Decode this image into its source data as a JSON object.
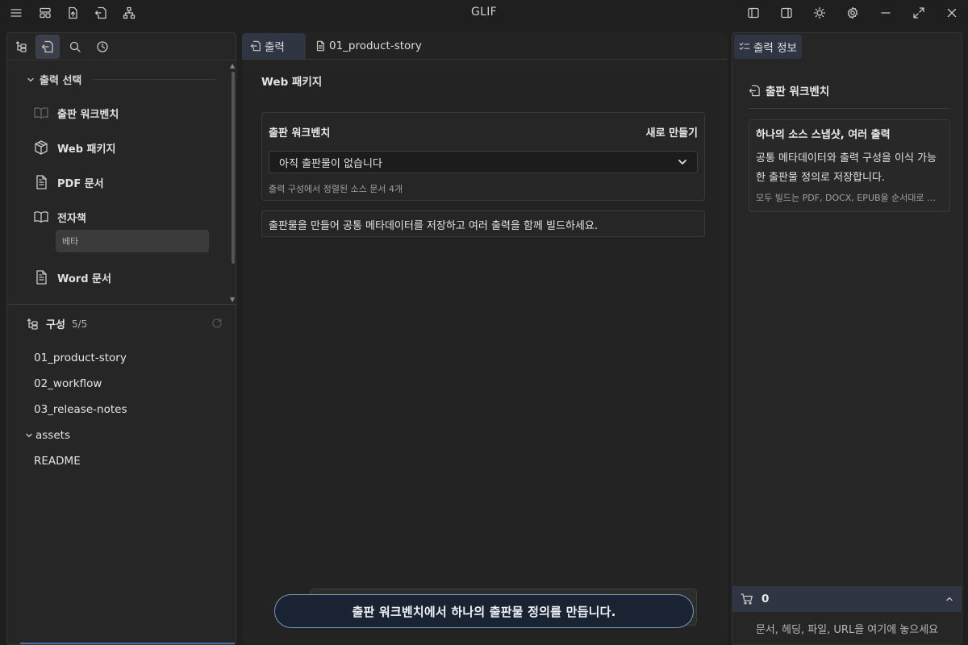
{
  "app": {
    "title": "GLIF"
  },
  "left": {
    "section_title": "출력 선택",
    "outputs": [
      {
        "label": "출판 워크벤치",
        "icon": "book-open-icon"
      },
      {
        "label": "Web 패키지",
        "icon": "package-icon"
      },
      {
        "label": "PDF 문서",
        "icon": "file-text-icon"
      },
      {
        "label": "전자책",
        "icon": "book-icon"
      },
      {
        "label": "Word 문서",
        "icon": "file-text-icon"
      }
    ],
    "beta_label": "베타",
    "structure": {
      "title": "구성",
      "count": "5/5",
      "items": [
        "01_product-story",
        "02_workflow",
        "03_release-notes"
      ],
      "folder": "assets",
      "folder_child": "README"
    }
  },
  "center": {
    "tabs": [
      {
        "label": "출력",
        "icon": "export-icon"
      },
      {
        "label": "01_product-story",
        "icon": "file-icon"
      }
    ],
    "heading": "Web 패키지",
    "card": {
      "title": "출판 워크벤치",
      "action": "새로 만들기",
      "select_value": "아직 출판물이 없습니다",
      "hint": "출력 구성에서 정렬된 소스 문서 4개"
    },
    "info": "출판물을 만들어 공통 메타데이터를 저장하고 여러 출력을 함께 빌드하세요.",
    "toast": "출판 워크벤치에서 하나의 출판물 정의를 만듭니다."
  },
  "right": {
    "tab_label": "출력 정보",
    "title": "출판 워크벤치",
    "card_title": "하나의 소스 스냅샷, 여러 출력",
    "card_desc": "공통 메타데이터와 출력 구성을 이식 가능한 출판물 정의로 저장합니다.",
    "card_note": "모두 빌드는 PDF, DOCX, EPUB을 순서대로 …",
    "cart_count": "0",
    "drop_hint": "문서, 헤딩, 파일, URL을 여기에 놓으세요"
  },
  "colors": {
    "background": "#1f1f1f",
    "panel": "#262626",
    "active_tab": "#2f3542",
    "toast_border": "#7d93b8"
  }
}
